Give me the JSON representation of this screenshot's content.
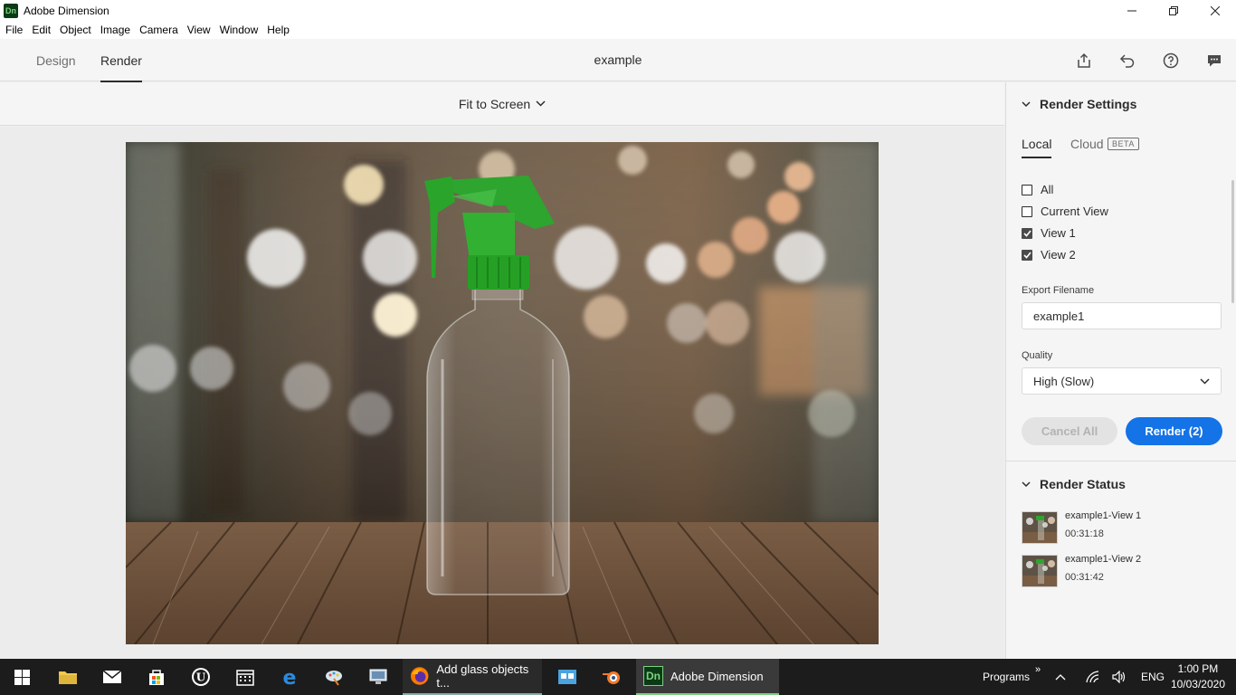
{
  "window": {
    "app_logo": "Dn",
    "title": "Adobe Dimension",
    "controls": [
      "minimize-icon",
      "restore-icon",
      "close-icon"
    ]
  },
  "menubar": {
    "items": [
      "File",
      "Edit",
      "Object",
      "Image",
      "Camera",
      "View",
      "Window",
      "Help"
    ]
  },
  "header": {
    "tabs": [
      {
        "label": "Design",
        "active": false
      },
      {
        "label": "Render",
        "active": true
      }
    ],
    "document_title": "example",
    "icons": [
      "share-icon",
      "undo-icon",
      "help-icon",
      "feedback-icon"
    ]
  },
  "canvas": {
    "zoom_label": "Fit to Screen",
    "scene": "Clear glass spray bottle with green trigger on a wooden table against a blurred bokeh background"
  },
  "render_settings": {
    "title": "Render Settings",
    "tabs": [
      {
        "label": "Local",
        "active": true
      },
      {
        "label": "Cloud",
        "active": false
      }
    ],
    "beta_badge": "BETA",
    "views": [
      {
        "label": "All",
        "checked": false
      },
      {
        "label": "Current View",
        "checked": false
      },
      {
        "label": "View 1",
        "checked": true
      },
      {
        "label": "View 2",
        "checked": true
      }
    ],
    "export_filename_label": "Export Filename",
    "export_filename_value": "example1",
    "quality_label": "Quality",
    "quality_value": "High (Slow)",
    "cancel_label": "Cancel All",
    "render_label": "Render (2)"
  },
  "render_status": {
    "title": "Render Status",
    "items": [
      {
        "name": "example1-View 1",
        "time": "00:31:18"
      },
      {
        "name": "example1-View 2",
        "time": "00:31:42"
      }
    ]
  },
  "taskbar": {
    "apps": [
      {
        "label": "Add glass objects t...",
        "icon": "firefox-icon"
      },
      {
        "label": "Adobe Dimension",
        "icon": "dimension-icon",
        "logo": "Dn"
      }
    ],
    "tray_programs": "Programs",
    "tray_chevron": "»",
    "language": "ENG",
    "time": "1:00 PM",
    "date": "10/03/2020"
  },
  "colors": {
    "accent": "#1473e6",
    "dimension_green": "#7fd081"
  }
}
